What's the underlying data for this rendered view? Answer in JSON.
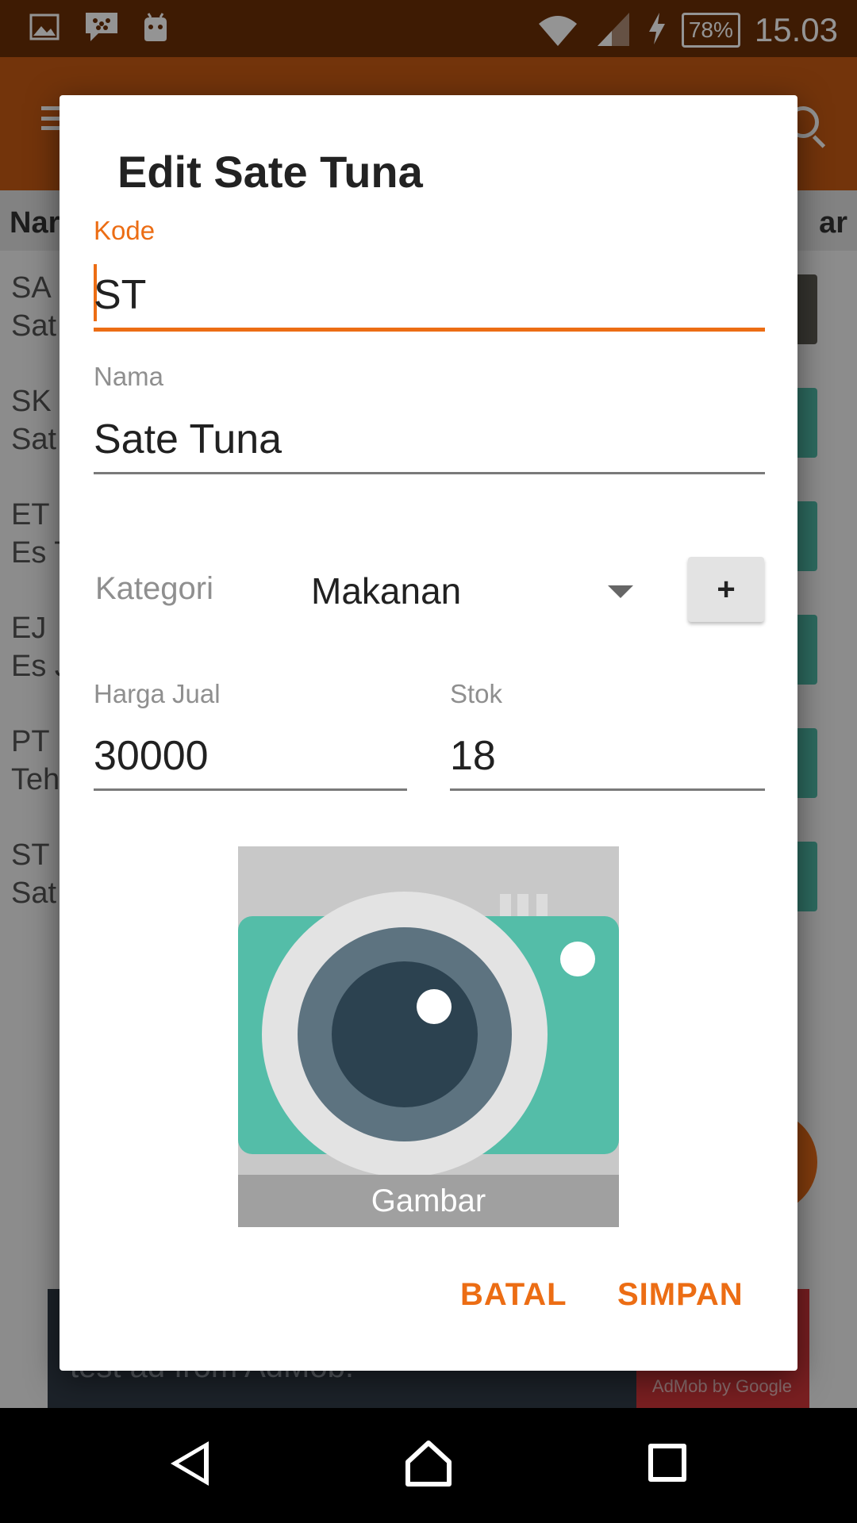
{
  "status_bar": {
    "battery": "78%",
    "time": "15.03",
    "icons": [
      "gallery-icon",
      "bbm-icon",
      "android-icon",
      "wifi-icon",
      "signal-icon",
      "charging-icon",
      "battery-icon"
    ]
  },
  "app": {
    "table_header": {
      "left": "Nar",
      "right": "ar"
    },
    "rows": [
      {
        "code": "SA",
        "name": "Sat"
      },
      {
        "code": "SK",
        "name": "Sat"
      },
      {
        "code": "ET",
        "name": "Es T"
      },
      {
        "code": "EJ",
        "name": "Es J"
      },
      {
        "code": "PT",
        "name": "Teh"
      },
      {
        "code": "ST",
        "name": "Sat"
      }
    ],
    "ad": {
      "text": "test ad from AdMob.",
      "badge": "AdMob by Google"
    }
  },
  "dialog": {
    "title": "Edit Sate Tuna",
    "kode": {
      "label": "Kode",
      "value": "ST"
    },
    "nama": {
      "label": "Nama",
      "value": "Sate Tuna"
    },
    "kategori": {
      "label": "Kategori",
      "value": "Makanan",
      "add_label": "+"
    },
    "harga_jual": {
      "label": "Harga Jual",
      "value": "30000"
    },
    "stok": {
      "label": "Stok",
      "value": "18"
    },
    "image": {
      "caption": "Gambar"
    },
    "buttons": {
      "cancel": "BATAL",
      "save": "SIMPAN"
    }
  },
  "colors": {
    "accent": "#ec6d14",
    "status_bar": "#6c2f06",
    "app_bar": "#c65a14",
    "camera_teal": "#4fb9a6"
  }
}
